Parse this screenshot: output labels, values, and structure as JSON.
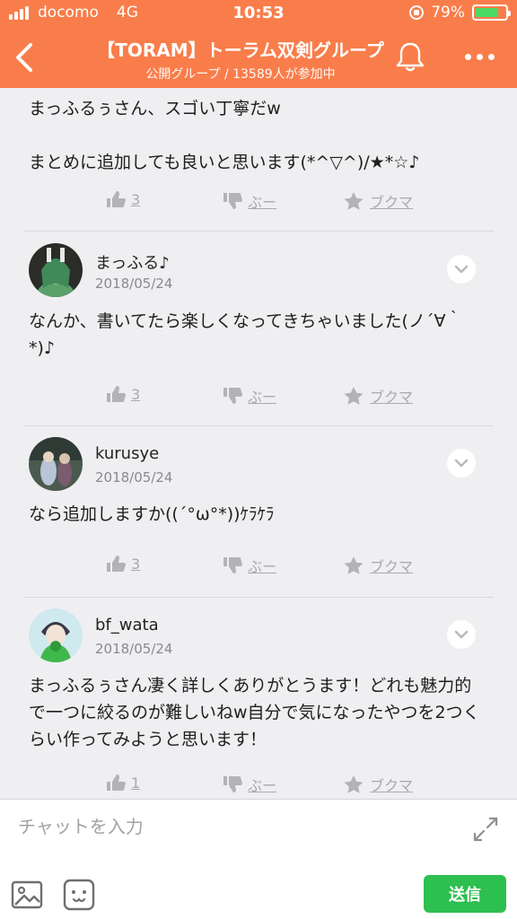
{
  "status_bar": {
    "carrier": "docomo",
    "network": "4G",
    "time": "10:53",
    "battery": "79%",
    "battery_level": 0.79
  },
  "header": {
    "title": "【TORAM】トーラム双剣グループ",
    "subtitle": "公開グループ / 13589人が参加中"
  },
  "colors": {
    "accent": "#f97d4a",
    "send": "#2dbf4f"
  },
  "posts": [
    {
      "text": "まっふるぅさん、スゴい丁寧だw\n\nまとめに追加しても良いと思います(*^▽^)/★*☆♪",
      "likes": "3",
      "boo": "ぶー",
      "bookmark": "ブクマ"
    },
    {
      "author": "まっふる♪",
      "date": "2018/05/24",
      "text": "なんか、書いてたら楽しくなってきちゃいました(ノ´∀｀*)♪",
      "likes": "3",
      "boo": "ぶー",
      "bookmark": "ブクマ"
    },
    {
      "author": "kurusye",
      "date": "2018/05/24",
      "text": "なら追加しますか((´°ω°*))ｹﾗｹﾗ",
      "likes": "3",
      "boo": "ぶー",
      "bookmark": "ブクマ"
    },
    {
      "author": "bf_wata",
      "date": "2018/05/24",
      "text": "まっふるぅさん凄く詳しくありがとうます！どれも魅力的で一つに絞るのが難しいねw自分で気になったやつを2つくらい作ってみようと思います！",
      "likes": "1",
      "boo": "ぶー",
      "bookmark": "ブクマ"
    }
  ],
  "input": {
    "placeholder": "チャットを入力",
    "send_label": "送信"
  }
}
